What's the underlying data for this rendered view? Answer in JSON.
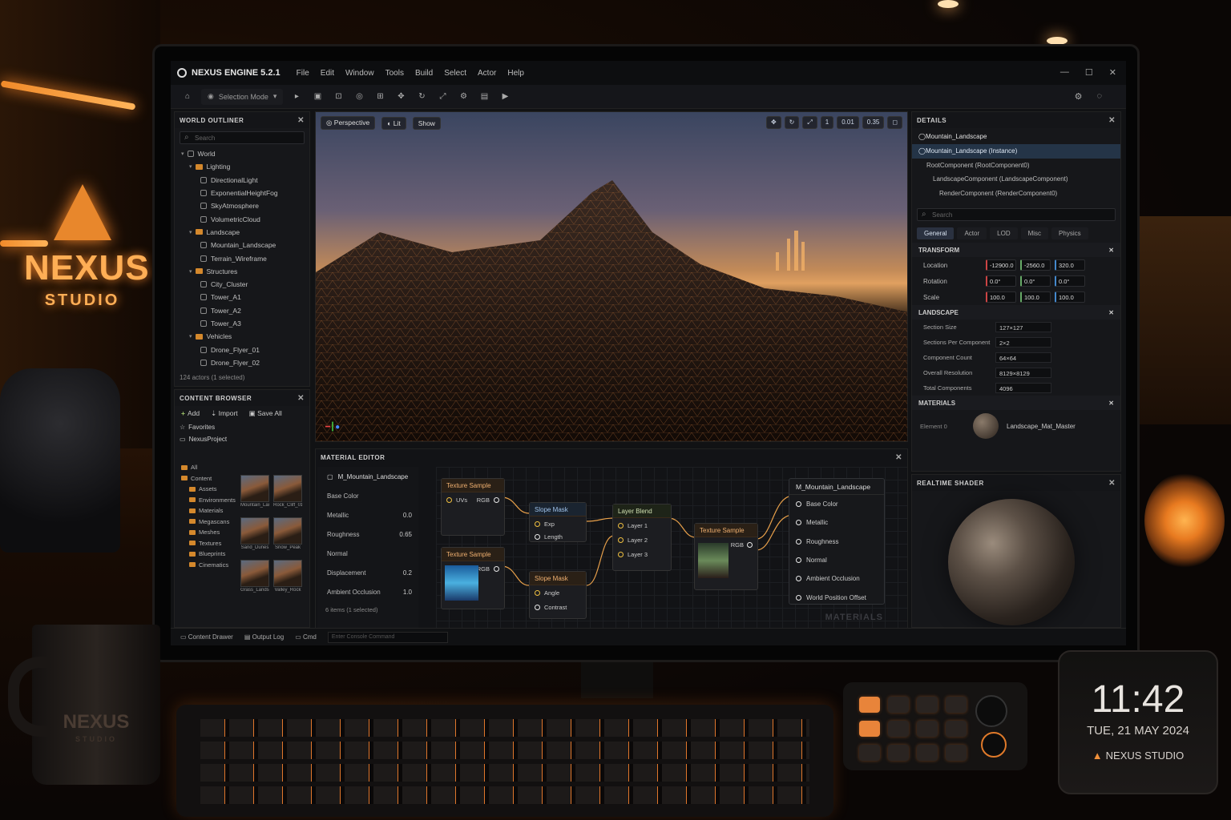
{
  "app": {
    "title": "NEXUS ENGINE 5.2.1",
    "menu": [
      "File",
      "Edit",
      "Window",
      "Tools",
      "Build",
      "Select",
      "Actor",
      "Help"
    ],
    "mode": "Selection Mode"
  },
  "outliner": {
    "title": "WORLD OUTLINER",
    "search_placeholder": "Search",
    "items": [
      {
        "label": "World",
        "type": "root"
      },
      {
        "label": "Lighting",
        "type": "folder"
      },
      {
        "label": "DirectionalLight",
        "type": "item"
      },
      {
        "label": "ExponentialHeightFog",
        "type": "item"
      },
      {
        "label": "SkyAtmosphere",
        "type": "item"
      },
      {
        "label": "VolumetricCloud",
        "type": "item"
      },
      {
        "label": "Landscape",
        "type": "folder"
      },
      {
        "label": "Mountain_Landscape",
        "type": "item"
      },
      {
        "label": "Terrain_Wireframe",
        "type": "item"
      },
      {
        "label": "Structures",
        "type": "folder"
      },
      {
        "label": "City_Cluster",
        "type": "item"
      },
      {
        "label": "Tower_A1",
        "type": "item"
      },
      {
        "label": "Tower_A2",
        "type": "item"
      },
      {
        "label": "Tower_A3",
        "type": "item"
      },
      {
        "label": "Vehicles",
        "type": "folder"
      },
      {
        "label": "Drone_Flyer_01",
        "type": "item"
      },
      {
        "label": "Drone_Flyer_02",
        "type": "item"
      }
    ],
    "footer": "124 actors (1 selected)"
  },
  "content_browser": {
    "title": "CONTENT BROWSER",
    "add": "Add",
    "import": "Import",
    "save_all": "Save All",
    "favorites": "Favorites",
    "project": "NexusProject",
    "folders": [
      "All",
      "Content",
      "Assets",
      "Environments",
      "Materials",
      "Megascans",
      "Meshes",
      "Textures",
      "Blueprints",
      "Cinematics"
    ],
    "thumbs": [
      "Mountain_Landscape",
      "Rock_Cliff_01",
      "Sand_Dunes",
      "Snow_Peak",
      "Grass_Landscape",
      "Valley_Rock"
    ]
  },
  "viewport": {
    "perspective": "Perspective",
    "lit": "Lit",
    "show": "Show",
    "right_chips": [
      "1",
      "0.01",
      "0.35"
    ]
  },
  "material_editor": {
    "title": "MATERIAL EDITOR",
    "material_name": "M_Mountain_Landscape",
    "params": [
      {
        "label": "Base Color",
        "value": ""
      },
      {
        "label": "Metallic",
        "value": "0.0"
      },
      {
        "label": "Roughness",
        "value": "0.65"
      },
      {
        "label": "Normal",
        "value": ""
      },
      {
        "label": "Displacement",
        "value": "0.2"
      },
      {
        "label": "Ambient Occlusion",
        "value": "1.0"
      }
    ],
    "footer": "6 items (1 selected)",
    "nodes": {
      "tex1": {
        "title": "Texture Sample",
        "pins": [
          "UVs",
          "RGB"
        ]
      },
      "tex2": {
        "title": "Texture Sample",
        "pins": [
          "RGB"
        ]
      },
      "slope": {
        "title": "Slope Mask",
        "pins": [
          "Exp",
          "Length"
        ]
      },
      "layer": {
        "title": "Layer Blend",
        "pins": [
          "Layer 1",
          "Layer 2",
          "Layer 3"
        ]
      },
      "tex3": {
        "title": "Texture Sample",
        "pins": [
          "UVs",
          "RGB"
        ]
      },
      "slope2": {
        "title": "Slope Mask",
        "pins": [
          "Angle",
          "Contrast"
        ]
      }
    },
    "output": {
      "title": "M_Mountain_Landscape",
      "pins": [
        "Base Color",
        "Metallic",
        "Roughness",
        "Normal",
        "Ambient Occlusion",
        "World Position Offset"
      ]
    },
    "watermark": "MATERIALS"
  },
  "details": {
    "title": "DETAILS",
    "object": "Mountain_Landscape",
    "instance": "Mountain_Landscape (Instance)",
    "components": [
      "RootComponent (RootComponent0)",
      "LandscapeComponent (LandscapeComponent)",
      "RenderComponent (RenderComponent0)"
    ],
    "search_placeholder": "Search",
    "tabs": [
      "General",
      "Actor",
      "LOD",
      "Misc",
      "Physics"
    ],
    "transform_label": "TRANSFORM",
    "transform": [
      {
        "label": "Location",
        "x": "-12900.0",
        "y": "-2560.0",
        "z": "320.0"
      },
      {
        "label": "Rotation",
        "x": "0.0°",
        "y": "0.0°",
        "z": "0.0°"
      },
      {
        "label": "Scale",
        "x": "100.0",
        "y": "100.0",
        "z": "100.0"
      }
    ],
    "landscape_label": "LANDSCAPE",
    "landscape": [
      {
        "label": "Section Size",
        "value": "127×127"
      },
      {
        "label": "Sections Per Component",
        "value": "2×2"
      },
      {
        "label": "Component Count",
        "value": "64×64"
      },
      {
        "label": "Overall Resolution",
        "value": "8129×8129"
      },
      {
        "label": "Total Components",
        "value": "4096"
      }
    ],
    "materials_label": "MATERIALS",
    "material_slot": "Element 0",
    "material_value": "Landscape_Mat_Master"
  },
  "shader": {
    "title": "REALTIME SHADER"
  },
  "statusbar": {
    "content_drawer": "Content Drawer",
    "output_log": "Output Log",
    "cmd": "Cmd",
    "console_placeholder": "Enter Console Command"
  },
  "room": {
    "sign_big": "NEXUS",
    "sign_small": "STUDIO",
    "mug_big": "NEXUS",
    "mug_small": "STUDIO",
    "clock_time": "11:42",
    "clock_date": "TUE, 21 MAY 2024",
    "clock_brand": "NEXUS STUDIO"
  }
}
